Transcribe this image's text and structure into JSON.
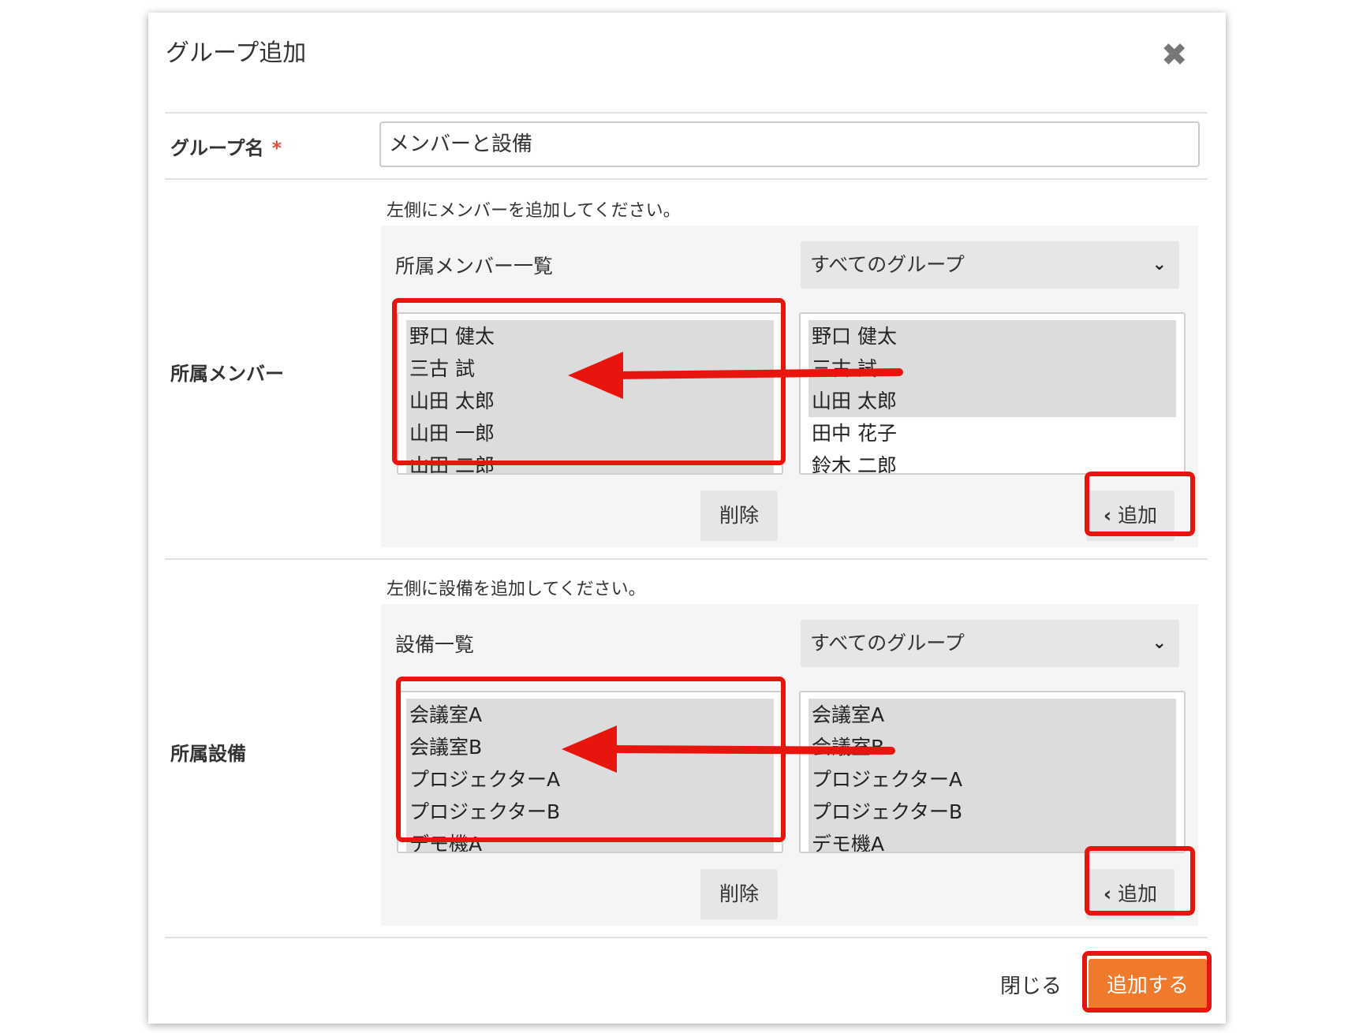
{
  "dialog": {
    "title": "グループ追加",
    "group_name_label": "グループ名",
    "required_mark": "*",
    "group_name_value": "メンバーと設備"
  },
  "members": {
    "section_label": "所属メンバー",
    "hint": "左側にメンバーを追加してください。",
    "list_title": "所属メンバー一覧",
    "group_select": "すべてのグループ",
    "selected_list": [
      {
        "label": "野口 健太",
        "selected": true
      },
      {
        "label": "三古 試",
        "selected": true
      },
      {
        "label": "山田 太郎",
        "selected": true
      },
      {
        "label": "山田 一郎",
        "selected": true
      },
      {
        "label": "山田 二郎",
        "selected": true
      }
    ],
    "available_list": [
      {
        "label": "野口 健太",
        "selected": true
      },
      {
        "label": "三古 試",
        "selected": true
      },
      {
        "label": "山田 太郎",
        "selected": true
      },
      {
        "label": "田中 花子",
        "selected": false
      },
      {
        "label": "鈴木 二郎",
        "selected": false
      }
    ],
    "delete_label": "削除",
    "add_label": "追加"
  },
  "facilities": {
    "section_label": "所属設備",
    "hint": "左側に設備を追加してください。",
    "list_title": "設備一覧",
    "group_select": "すべてのグループ",
    "selected_list": [
      {
        "label": "会議室A",
        "selected": true
      },
      {
        "label": "会議室B",
        "selected": true
      },
      {
        "label": "プロジェクターA",
        "selected": true
      },
      {
        "label": "プロジェクターB",
        "selected": true
      },
      {
        "label": "デモ機A",
        "selected": true
      }
    ],
    "available_list": [
      {
        "label": "会議室A",
        "selected": true
      },
      {
        "label": "会議室B",
        "selected": true
      },
      {
        "label": "プロジェクターA",
        "selected": true
      },
      {
        "label": "プロジェクターB",
        "selected": true
      },
      {
        "label": "デモ機A",
        "selected": true
      }
    ],
    "delete_label": "削除",
    "add_label": "追加"
  },
  "footer": {
    "close_label": "閉じる",
    "submit_label": "追加する"
  },
  "icons": {
    "close": "close-icon",
    "chevron_down": "chevron-down-icon",
    "chevron_left": "chevron-left-icon"
  },
  "colors": {
    "highlight": "#e8150f",
    "submit": "#f07a2c"
  }
}
